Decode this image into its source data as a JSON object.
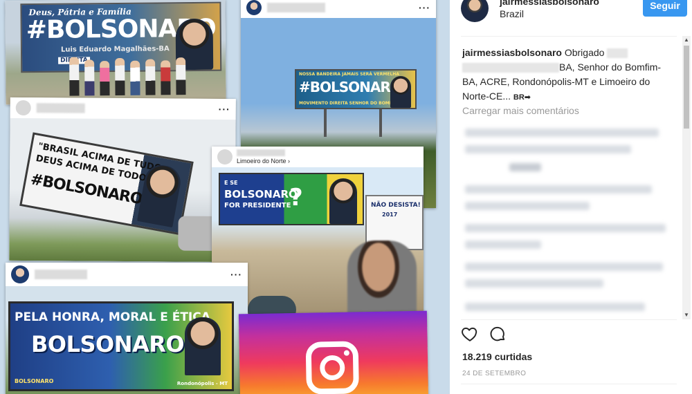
{
  "header": {
    "username": "jairmessiasbolsonaro",
    "location": "Brazil",
    "follow_label": "Seguir"
  },
  "caption": {
    "username": "jairmessiasbolsonaro",
    "text_start": "Obrigado",
    "text_body": "BA, Senhor do Bomfim-BA, ACRE, Rondonópolis-MT e Limoeiro do Norte-CE...",
    "translate_label": "BR➡"
  },
  "load_more_label": "Carregar mais comentários",
  "likes_label": "18.219 curtidas",
  "date_label": "24 DE SETEMBRO",
  "icons": {
    "like": "heart-icon",
    "comment": "comment-icon",
    "more": "ellipsis-icon"
  },
  "collage": {
    "card1": {
      "top_text": "Deus, Pátria e Família",
      "headline": "#BOLSONARO",
      "sub": "Luis Eduardo Magalhães-BA",
      "corner": "DIREITA"
    },
    "card2": {
      "top_text": "NOSSA BANDEIRA JAMAIS SERÁ VERMELHA",
      "headline": "#BOLSONARO",
      "footer": "MOVIMENTO DIREITA SENHOR DO BOMFIM - BA"
    },
    "card3": {
      "line1": "\"BRASIL ACIMA DE TUDO,",
      "line2": "DEUS ACIMA DE TODOS\"",
      "headline": "#BOLSONARO"
    },
    "card4": {
      "location": "Limoeiro do Norte ›",
      "small": "E SE",
      "headline": "BOLSONARO",
      "sub": "FOR PRESIDENTE",
      "question": "?",
      "side": "NÃO DESISTA!",
      "year": "2017"
    },
    "card5": {
      "line": "PELA HONRA, MORAL E ÉTICA",
      "headline": "BOLSONARO",
      "corner": "Rondonópolis - MT",
      "badge": "BOLSONARO"
    }
  },
  "colors": {
    "follow": "#3897f0",
    "text": "#262626",
    "muted": "#999999"
  }
}
